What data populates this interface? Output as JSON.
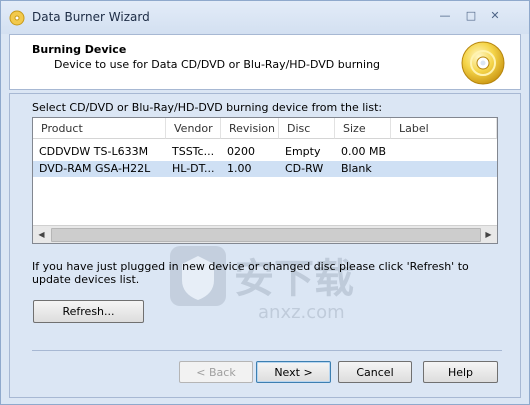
{
  "window": {
    "title": "Data Burner Wizard"
  },
  "header": {
    "title": "Burning Device",
    "subtitle": "Device to use for Data CD/DVD or Blu-Ray/HD-DVD burning"
  },
  "device_list": {
    "label": "Select CD/DVD or Blu-Ray/HD-DVD burning device from the list:",
    "columns": [
      "Product",
      "Vendor",
      "Revision",
      "Disc",
      "Size",
      "Label"
    ],
    "rows": [
      {
        "product": "CDDVDW TS-L633M",
        "vendor": "TSSTc...",
        "revision": "0200",
        "disc": "Empty",
        "size": "0.00 MB",
        "label": ""
      },
      {
        "product": "DVD-RAM GSA-H22L",
        "vendor": "HL-DT...",
        "revision": "1.00",
        "disc": "CD-RW",
        "size": "Blank",
        "label": ""
      }
    ],
    "selected_row": 1
  },
  "info_text": "If you have just plugged in new device or changed disc please click 'Refresh' to update devices list.",
  "buttons": {
    "refresh": "Refresh...",
    "back": "< Back",
    "next": "Next >",
    "cancel": "Cancel",
    "help": "Help"
  },
  "watermark": {
    "text": "安下载",
    "sub": "anxz.com"
  },
  "colors": {
    "accent": "#3c7fb1",
    "selected_row": "#cfe0f4",
    "panel_bg": "#dbe6f4"
  }
}
